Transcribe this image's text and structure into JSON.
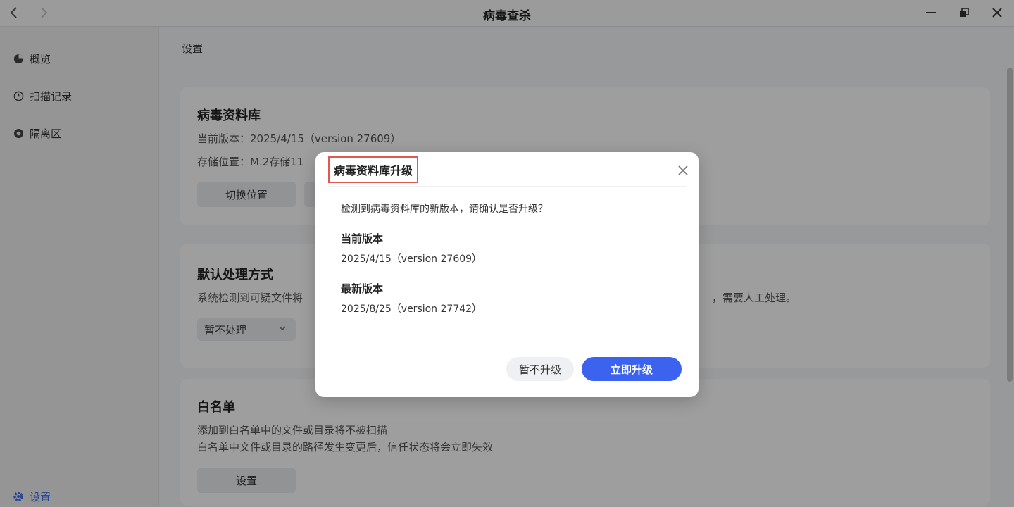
{
  "window": {
    "title": "病毒查杀"
  },
  "sidebar": {
    "items": [
      {
        "label": "概览",
        "icon": "overview-icon"
      },
      {
        "label": "扫描记录",
        "icon": "history-icon"
      },
      {
        "label": "隔离区",
        "icon": "quarantine-icon"
      }
    ],
    "settings_label": "设置"
  },
  "main": {
    "breadcrumb": "设置",
    "virus_db": {
      "title": "病毒资料库",
      "current_version": "当前版本：2025/4/15（version 27609）",
      "storage_location": "存储位置：M.2存储11",
      "switch_button": "切换位置"
    },
    "default_action": {
      "title": "默认处理方式",
      "description_left": "系统检测到可疑文件将",
      "description_right": "，需要人工处理。",
      "select_value": "暂不处理"
    },
    "whitelist": {
      "title": "白名单",
      "line1": "添加到白名单中的文件或目录将不被扫描",
      "line2": "白名单中文件或目录的路径发生变更后，信任状态将会立即失效",
      "button": "设置"
    }
  },
  "dialog": {
    "title": "病毒资料库升级",
    "message": "检测到病毒资料库的新版本，请确认是否升级？",
    "current_label": "当前版本",
    "current_value": "2025/4/15（version 27609）",
    "latest_label": "最新版本",
    "latest_value": "2025/8/25（version 27742）",
    "later_button": "暂不升级",
    "upgrade_button": "立即升级"
  },
  "colors": {
    "accent": "#3b63f0",
    "highlight_border": "#e0584f"
  }
}
